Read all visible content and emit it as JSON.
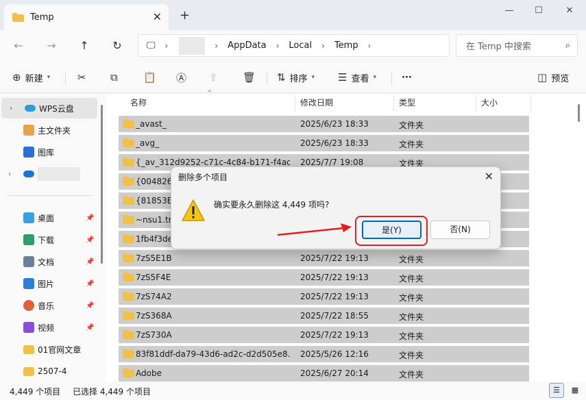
{
  "window": {
    "tab_title": "Temp",
    "new_tab": "+",
    "minimize": "—",
    "maximize": "☐",
    "close": "✕"
  },
  "address": {
    "crumbs": [
      "AppData",
      "Local",
      "Temp"
    ],
    "search_placeholder": "在 Temp 中搜索"
  },
  "toolbar": {
    "new_label": "新建",
    "sort_label": "排序",
    "view_label": "查看",
    "more_label": "···",
    "preview_label": "预览"
  },
  "sidebar": {
    "items": [
      {
        "label": "WPS云盘",
        "icon": "cloud-icon"
      },
      {
        "label": "主文件夹",
        "icon": "home-icon"
      },
      {
        "label": "图库",
        "icon": "gallery-icon"
      },
      {
        "label": "",
        "icon": "onedrive-icon"
      },
      {
        "label": "桌面",
        "icon": "desktop-icon"
      },
      {
        "label": "下载",
        "icon": "download-icon"
      },
      {
        "label": "文档",
        "icon": "document-icon"
      },
      {
        "label": "图片",
        "icon": "pictures-icon"
      },
      {
        "label": "音乐",
        "icon": "music-icon"
      },
      {
        "label": "视频",
        "icon": "video-icon"
      },
      {
        "label": "01官网文章",
        "icon": "folder-icon"
      },
      {
        "label": "2507-4",
        "icon": "folder-icon"
      }
    ]
  },
  "columns": {
    "name": "名称",
    "date": "修改日期",
    "type": "类型",
    "size": "大小"
  },
  "files": [
    {
      "name": "_avast_",
      "date": "2025/6/23 18:33",
      "type": "文件夹"
    },
    {
      "name": "_avg_",
      "date": "2025/6/23 18:33",
      "type": "文件夹"
    },
    {
      "name": "{_av_312d9252-c71c-4c84-b171-f4ad...",
      "date": "2025/7/7 19:08",
      "type": "文件夹"
    },
    {
      "name": "{004826C",
      "date": "",
      "type": ""
    },
    {
      "name": "{81853E0",
      "date": "",
      "type": ""
    },
    {
      "name": "~nsu1.tm",
      "date": "",
      "type": ""
    },
    {
      "name": "1fb4f3de",
      "date": "",
      "type": ""
    },
    {
      "name": "7zS5E1B",
      "date": "2025/7/22 19:13",
      "type": "文件夹"
    },
    {
      "name": "7zS5F4E",
      "date": "2025/7/22 19:13",
      "type": "文件夹"
    },
    {
      "name": "7zS74A2",
      "date": "2025/7/22 19:13",
      "type": "文件夹"
    },
    {
      "name": "7zS368A",
      "date": "2025/7/22 18:55",
      "type": "文件夹"
    },
    {
      "name": "7zS730A",
      "date": "2025/7/22 19:13",
      "type": "文件夹"
    },
    {
      "name": "83f81ddf-da79-43d6-ad2c-d2d505e8...",
      "date": "2025/5/26 12:16",
      "type": "文件夹"
    },
    {
      "name": "Adobe",
      "date": "2025/6/27 20:14",
      "type": "文件夹"
    }
  ],
  "status": {
    "count": "4,449 个项目",
    "selected": "已选择 4,449 个项目"
  },
  "dialog": {
    "title": "删除多个项目",
    "message": "确实要永久删除这 4,449 项吗?",
    "yes": "是(Y)",
    "no": "否(N)"
  },
  "colors": {
    "accent": "#0067c0",
    "highlight": "#e41e1e",
    "folder": "#f0c04a"
  }
}
